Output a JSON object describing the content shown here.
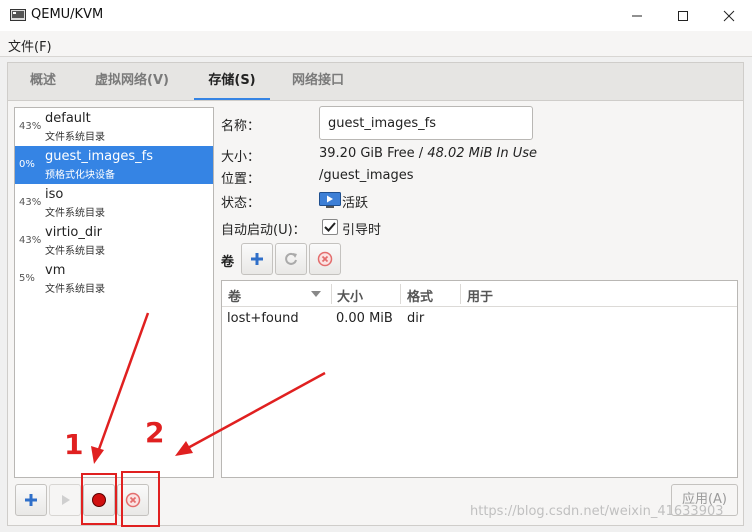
{
  "window": {
    "title": "QEMU/KVM"
  },
  "menu": {
    "file": "文件(F)"
  },
  "tabs": [
    {
      "label": "概述"
    },
    {
      "label": "虚拟网络(V)"
    },
    {
      "label": "存储(S)",
      "selected": true
    },
    {
      "label": "网络接口"
    }
  ],
  "pools": [
    {
      "percent": "43%",
      "name": "default",
      "type": "文件系统目录"
    },
    {
      "percent": "0%",
      "name": "guest_images_fs",
      "type": "预格式化块设备",
      "selected": true
    },
    {
      "percent": "43%",
      "name": "iso",
      "type": "文件系统目录"
    },
    {
      "percent": "43%",
      "name": "virtio_dir",
      "type": "文件系统目录"
    },
    {
      "percent": "5%",
      "name": "vm",
      "type": "文件系统目录"
    }
  ],
  "details": {
    "name_label": "名称：",
    "name_value": "guest_images_fs",
    "size_label": "大小：",
    "size_free": "39.20 GiB Free / ",
    "size_used": "48.02 MiB In Use",
    "location_label": "位置：",
    "location_value": "/guest_images",
    "state_label": "状态：",
    "state_value": "活跃",
    "autostart_label": "自动启动(U)：",
    "autostart_value": "引导时",
    "autostart_checked": true
  },
  "volumes": {
    "label": "卷",
    "columns": [
      "卷",
      "大小",
      "格式",
      "用于"
    ],
    "rows": [
      {
        "name": "lost+found",
        "size": "0.00 MiB",
        "format": "dir",
        "used_by": ""
      }
    ]
  },
  "footer": {
    "apply": "应用(A)"
  },
  "annotations": {
    "one": "1",
    "two": "2",
    "color": "#e02020"
  },
  "watermark": "https://blog.csdn.net/weixin_41633903",
  "colors": {
    "accent": "#3584e4",
    "add_icon": "#2f6fc9",
    "delete_icon": "#e36d6d",
    "record_icon": "#d01010"
  }
}
